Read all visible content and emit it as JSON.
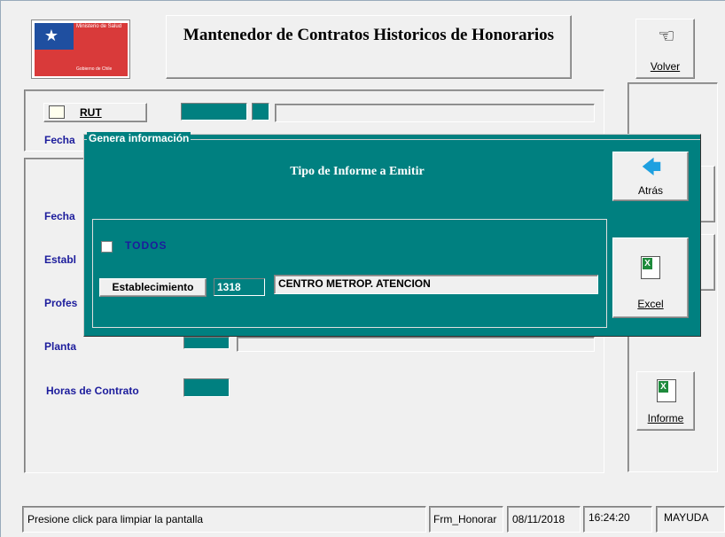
{
  "header": {
    "logo_text": "Ministerio de Salud",
    "logo_sub": "Gobierno de Chile",
    "title": "Mantenedor de Contratos Historicos de Honorarios",
    "volver_label": "Volver"
  },
  "form": {
    "rut_button": "RUT",
    "fecha1_label": "Fecha",
    "fecha2_label": "Fecha",
    "establ_label": "Establ",
    "profes_label": "Profes",
    "planta_label": "Planta",
    "horas_label": "Horas de Contrato",
    "informe_label": "Informe"
  },
  "dialog": {
    "title": "Genera información",
    "heading": "Tipo de Informe a Emitir",
    "atras_label": "Atrás",
    "excel_label": "Excel",
    "todos_label": "TODOS",
    "establecimiento_button": "Establecimiento",
    "establecimiento_code": "1318",
    "establecimiento_name": "CENTRO METROP. ATENCION"
  },
  "statusbar": {
    "message": "Presione click para limpiar la pantalla",
    "form_name": "Frm_Honorar",
    "date": "08/11/2018",
    "time": "16:24:20",
    "caps": "MAYUDA"
  },
  "colors": {
    "teal": "#008080",
    "label_blue": "#1c1c9c"
  }
}
